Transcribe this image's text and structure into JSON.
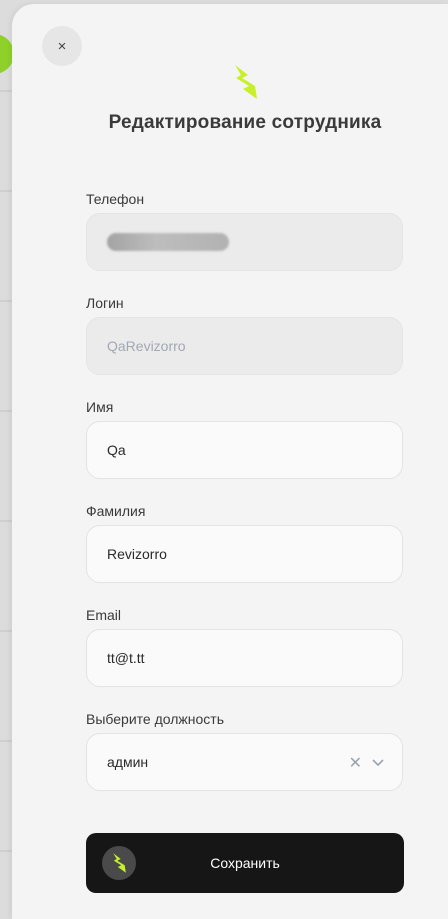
{
  "modal": {
    "title": "Редактирование сотрудника",
    "close_symbol": "×",
    "close_icon": "close-icon",
    "logo_icon": "lightning-bolt-icon",
    "accent_color": "#c8f02a"
  },
  "form": {
    "phone": {
      "label": "Телефон",
      "value": ""
    },
    "login": {
      "label": "Логин",
      "value": "QaRevizorro"
    },
    "first_name": {
      "label": "Имя",
      "value": "Qa"
    },
    "last_name": {
      "label": "Фамилия",
      "value": "Revizorro"
    },
    "email": {
      "label": "Email",
      "value": "tt@t.tt"
    },
    "position": {
      "label": "Выберите должность",
      "value": "админ",
      "clear_symbol": "✕",
      "chevron_symbol": "⌄"
    }
  },
  "save_button": {
    "label": "Сохранить",
    "icon": "lightning-bolt-icon"
  }
}
